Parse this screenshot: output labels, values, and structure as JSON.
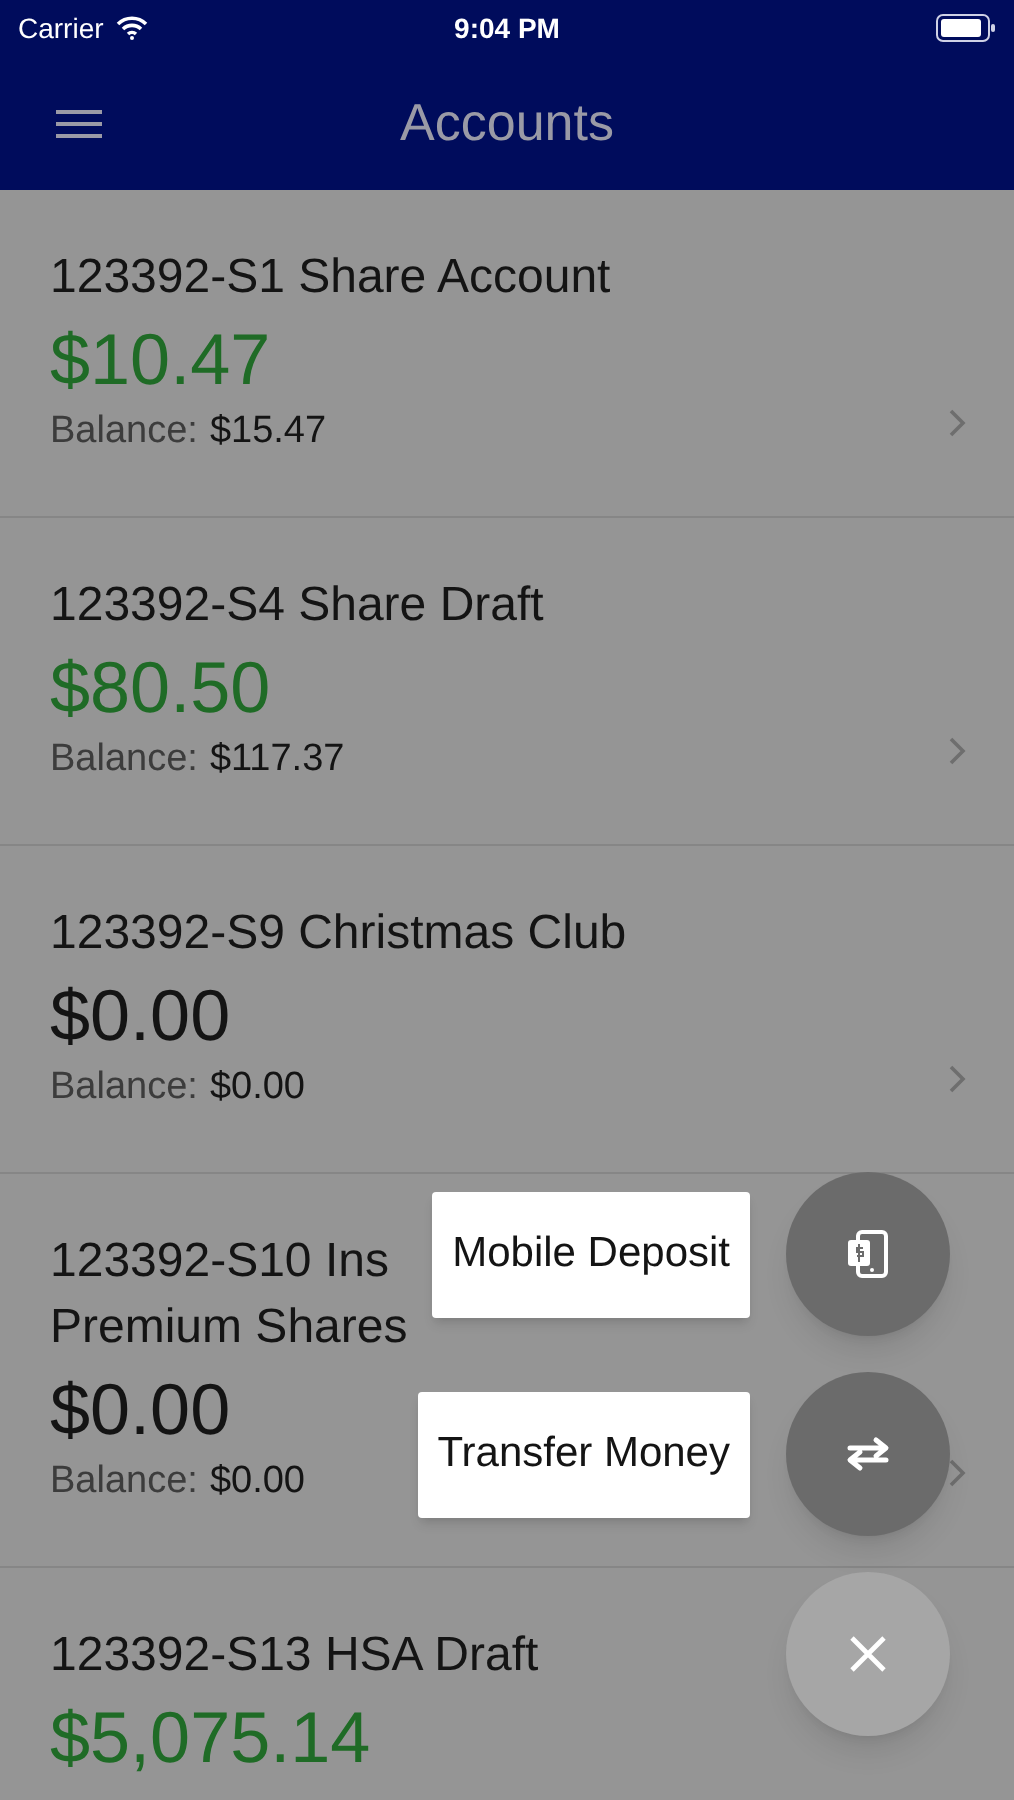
{
  "status_bar": {
    "carrier": "Carrier",
    "time": "9:04 PM"
  },
  "nav": {
    "title": "Accounts"
  },
  "accounts": [
    {
      "name": "123392-S1 Share Account",
      "amount": "$10.47",
      "kind": "positive",
      "balance_label": "Balance:",
      "balance": "$15.47"
    },
    {
      "name": "123392-S4 Share Draft",
      "amount": "$80.50",
      "kind": "positive",
      "balance_label": "Balance:",
      "balance": "$117.37"
    },
    {
      "name": "123392-S9 Christmas Club",
      "amount": "$0.00",
      "kind": "zero",
      "balance_label": "Balance:",
      "balance": "$0.00"
    },
    {
      "name": "123392-S10 Ins",
      "name_line_2": "Premium Shares",
      "amount": "$0.00",
      "kind": "zero",
      "balance_label": "Balance:",
      "balance": "$0.00"
    },
    {
      "name": "123392-S13 HSA Draft",
      "amount": "$5,075.14",
      "kind": "positive"
    }
  ],
  "fab_menu": [
    {
      "label": "Mobile Deposit",
      "kind": "deposit"
    },
    {
      "label": "Transfer Money",
      "kind": "transfer"
    }
  ]
}
